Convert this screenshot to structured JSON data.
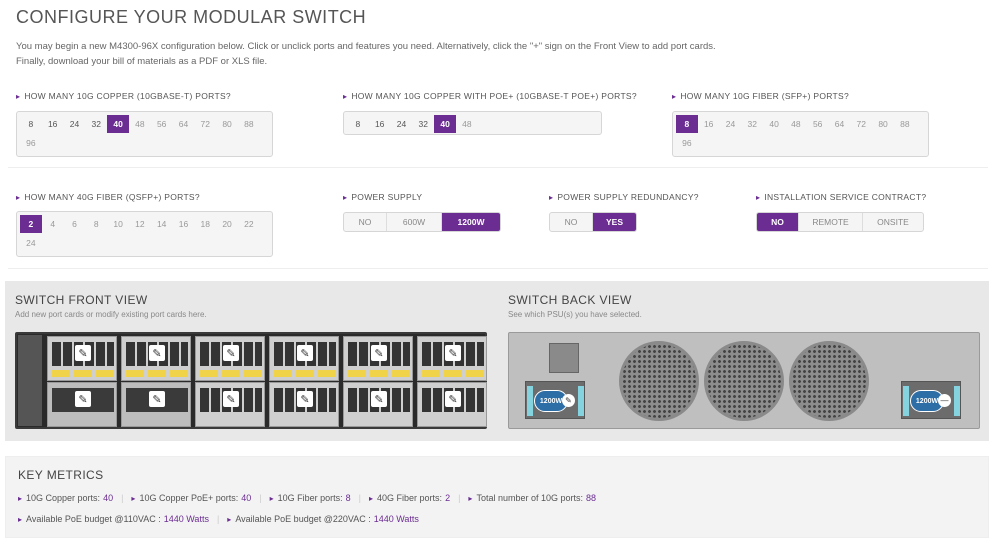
{
  "title": "CONFIGURE YOUR MODULAR SWITCH",
  "intro": {
    "line1": "You may begin a new M4300-96X configuration below. Click or unclick ports and features you need. Alternatively, click the \"+\" sign on the Front View to add port cards.",
    "line2": "Finally, download your bill of materials as a PDF or XLS file."
  },
  "questions": {
    "copper": {
      "label": "HOW MANY 10G COPPER (10GBASE-T) PORTS?",
      "options": [
        "8",
        "16",
        "24",
        "32",
        "40",
        "48",
        "56",
        "64",
        "72",
        "80",
        "88",
        "96"
      ],
      "selected": "40"
    },
    "poe": {
      "label": "HOW MANY 10G COPPER WITH POE+ (10GBASE-T POE+) PORTS?",
      "options": [
        "8",
        "16",
        "24",
        "32",
        "40",
        "48"
      ],
      "selected": "40"
    },
    "fiber": {
      "label": "HOW MANY 10G FIBER (SFP+) PORTS?",
      "options": [
        "8",
        "16",
        "24",
        "32",
        "40",
        "48",
        "56",
        "64",
        "72",
        "80",
        "88",
        "96"
      ],
      "selected": "8"
    },
    "qsfp": {
      "label": "HOW MANY 40G FIBER (QSFP+) PORTS?",
      "options": [
        "2",
        "4",
        "6",
        "8",
        "10",
        "12",
        "14",
        "16",
        "18",
        "20",
        "22",
        "24"
      ],
      "selected": "2"
    },
    "power": {
      "label": "POWER SUPPLY",
      "options": [
        "NO",
        "600W",
        "1200W"
      ],
      "selected": "1200W"
    },
    "redundancy": {
      "label": "POWER SUPPLY REDUNDANCY?",
      "options": [
        "NO",
        "YES"
      ],
      "selected": "YES"
    },
    "install": {
      "label": "INSTALLATION SERVICE CONTRACT?",
      "options": [
        "NO",
        "REMOTE",
        "ONSITE"
      ],
      "selected": "NO"
    }
  },
  "front_view": {
    "title": "SWITCH FRONT VIEW",
    "subtitle": "Add new port cards or modify existing port cards here."
  },
  "back_view": {
    "title": "SWITCH BACK VIEW",
    "subtitle": "See which PSU(s) you have selected.",
    "psu_label": "1200W"
  },
  "metrics": {
    "title": "KEY METRICS",
    "row1": [
      {
        "label": "10G Copper ports:",
        "value": "40"
      },
      {
        "label": "10G Copper PoE+ ports:",
        "value": "40"
      },
      {
        "label": "10G Fiber ports:",
        "value": "8"
      },
      {
        "label": "40G Fiber ports:",
        "value": "2"
      },
      {
        "label": "Total number of 10G ports:",
        "value": "88"
      }
    ],
    "row2": [
      {
        "label": "Available PoE budget @110VAC :",
        "value": "1440 Watts"
      },
      {
        "label": "Available PoE budget @220VAC :",
        "value": "1440 Watts"
      }
    ]
  },
  "colors": {
    "accent": "#6b2d92",
    "psu_badge": "#2e6ea6"
  }
}
